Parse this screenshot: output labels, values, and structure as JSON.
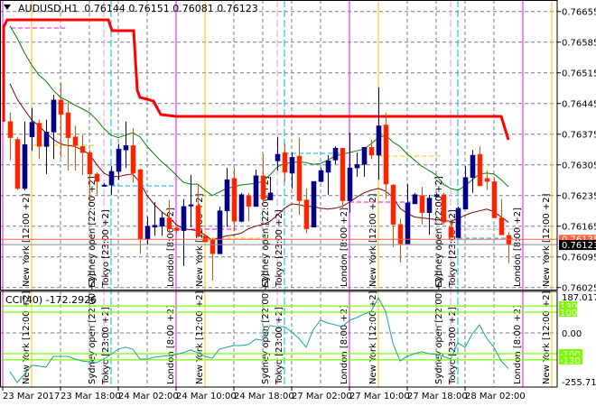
{
  "header": {
    "symbol": "AUDUSD,H1",
    "ohlc": "0.76144 0.76151 0.76081 0.76123",
    "menu_icon": "triangle-down-icon"
  },
  "cci": {
    "title": "CCI(40) -172.2926",
    "scale_max_label": "187.0175",
    "scale_zero_label": "0.00",
    "scale_min_label": "-255.7108",
    "levels": [
      130,
      100,
      -100,
      -130
    ],
    "level_labels": [
      "130",
      "100",
      "-100",
      "-130"
    ],
    "values": [
      -187,
      -239,
      -200,
      -156,
      -160,
      -165,
      -113,
      -113,
      -113,
      -126,
      -135,
      -139,
      -143,
      -126,
      -104,
      -78,
      -69,
      -78,
      -126,
      -126,
      -117,
      -113,
      -109,
      -104,
      -95,
      -82,
      -95,
      -113,
      -122,
      -78,
      -69,
      -61,
      -61,
      -56,
      -30,
      -35,
      35,
      30,
      30,
      4,
      -26,
      -69,
      17,
      61,
      48,
      39,
      30,
      61,
      74,
      91,
      104,
      169,
      104,
      -48,
      -135,
      -113,
      -100,
      -91,
      -100,
      -104,
      -113,
      -126,
      -48,
      -69,
      -4,
      39,
      -26,
      -69,
      -135,
      -172
    ]
  },
  "price_axis": {
    "labels": [
      "0.76655",
      "0.76585",
      "0.76515",
      "0.76445",
      "0.76375",
      "0.76305",
      "0.76235",
      "0.76165",
      "0.76095",
      "0.76025"
    ],
    "ask_label": "0.76135",
    "bid_label": "0.76123"
  },
  "time_axis": {
    "labels": [
      "23 Mar 2017",
      "23 Mar 18:00",
      "24 Mar 02:00",
      "24 Mar 10:00",
      "24 Mar 18:00",
      "27 Mar 02:00",
      "27 Mar 10:00",
      "27 Mar 18:00",
      "28 Mar 02:00"
    ]
  },
  "sessions": [
    {
      "label": "New York  [12:00 +2]",
      "color": "#FFC000"
    },
    {
      "label": "Sydney open  [22:00 +2]",
      "color": "#D8A0D8"
    },
    {
      "label": "Tokyo  [23:00 +2]",
      "color": "#00B0F0"
    },
    {
      "label": "London  [8:00 +2]",
      "color": "#FF00FF"
    }
  ],
  "colors": {
    "bull": "#000080",
    "bear": "#FF2000",
    "bear_wick": "#FF4500",
    "ma_fast": "#008000",
    "ma_slow": "#800000",
    "step_line": "#FF0000",
    "cci_line": "#20A0A0",
    "cci_level": "#7CFC00",
    "ask": "#FF6040",
    "bid": "#000000"
  },
  "candles": [
    [
      0.76404,
      0.76424,
      0.76316,
      0.76367
    ],
    [
      0.76363,
      0.76369,
      0.76247,
      0.76251
    ],
    [
      0.76251,
      0.76404,
      0.76247,
      0.76351
    ],
    [
      0.76369,
      0.76435,
      0.76337,
      0.76402
    ],
    [
      0.764,
      0.76408,
      0.76318,
      0.76347
    ],
    [
      0.76347,
      0.76408,
      0.76284,
      0.7638
    ],
    [
      0.7638,
      0.76465,
      0.76318,
      0.76453
    ],
    [
      0.76453,
      0.76492,
      0.76322,
      0.7642
    ],
    [
      0.76424,
      0.76449,
      0.76292,
      0.76367
    ],
    [
      0.76369,
      0.76394,
      0.76292,
      0.76349
    ],
    [
      0.76347,
      0.76373,
      0.76282,
      0.76333
    ],
    [
      0.76333,
      0.76339,
      0.7622,
      0.76284
    ],
    [
      0.76284,
      0.76288,
      0.76237,
      0.76267
    ],
    [
      0.76259,
      0.76263,
      0.76255,
      0.76259
    ],
    [
      0.76259,
      0.76302,
      0.76237,
      0.7629
    ],
    [
      0.7629,
      0.76353,
      0.76271,
      0.76341
    ],
    [
      0.76339,
      0.76404,
      0.76298,
      0.76349
    ],
    [
      0.76349,
      0.76388,
      0.76265,
      0.76286
    ],
    [
      0.76294,
      0.76296,
      0.76102,
      0.76135
    ],
    [
      0.76135,
      0.76186,
      0.76123,
      0.76165
    ],
    [
      0.76163,
      0.7622,
      0.76143,
      0.76167
    ],
    [
      0.76165,
      0.76196,
      0.76143,
      0.76184
    ],
    [
      0.76184,
      0.76225,
      0.76145,
      0.76159
    ],
    [
      0.76161,
      0.76165,
      0.76149,
      0.76155
    ],
    [
      0.76155,
      0.76227,
      0.76074,
      0.7621
    ],
    [
      0.76212,
      0.76282,
      0.76163,
      0.76214
    ],
    [
      0.76212,
      0.76261,
      0.76139,
      0.76143
    ],
    [
      0.76143,
      0.76145,
      0.76129,
      0.76129
    ],
    [
      0.76133,
      0.76139,
      0.76041,
      0.76102
    ],
    [
      0.76102,
      0.7621,
      0.76102,
      0.762
    ],
    [
      0.762,
      0.76298,
      0.76163,
      0.76271
    ],
    [
      0.76274,
      0.76298,
      0.76153,
      0.76176
    ],
    [
      0.76176,
      0.76241,
      0.76174,
      0.76237
    ],
    [
      0.76235,
      0.76241,
      0.76176,
      0.7621
    ],
    [
      0.7621,
      0.76294,
      0.7621,
      0.7628
    ],
    [
      0.7628,
      0.76329,
      0.76216,
      0.76227
    ],
    [
      0.76225,
      0.76278,
      0.76225,
      0.76241
    ],
    [
      0.76314,
      0.76369,
      0.76292,
      0.76329
    ],
    [
      0.76333,
      0.76353,
      0.76267,
      0.76288
    ],
    [
      0.76286,
      0.76333,
      0.76251,
      0.76322
    ],
    [
      0.76325,
      0.76367,
      0.7619,
      0.76223
    ],
    [
      0.76225,
      0.76251,
      0.76149,
      0.76159
    ],
    [
      0.76163,
      0.76267,
      0.76163,
      0.76267
    ],
    [
      0.76267,
      0.76298,
      0.76265,
      0.76292
    ],
    [
      0.76288,
      0.76327,
      0.76237,
      0.76314
    ],
    [
      0.76316,
      0.76347,
      0.76306,
      0.76343
    ],
    [
      0.76343,
      0.76343,
      0.76204,
      0.76223
    ],
    [
      0.76223,
      0.76378,
      0.76196,
      0.76298
    ],
    [
      0.76298,
      0.76333,
      0.76278,
      0.76306
    ],
    [
      0.76306,
      0.76345,
      0.76278,
      0.76345
    ],
    [
      0.76345,
      0.76363,
      0.76318,
      0.76327
    ],
    [
      0.76327,
      0.76482,
      0.76271,
      0.76394
    ],
    [
      0.76396,
      0.76424,
      0.76227,
      0.76261
    ],
    [
      0.76259,
      0.76261,
      0.76118,
      0.76169
    ],
    [
      0.76169,
      0.76182,
      0.76082,
      0.76125
    ],
    [
      0.76125,
      0.76261,
      0.76123,
      0.76218
    ],
    [
      0.76216,
      0.76241,
      0.76216,
      0.76237
    ],
    [
      0.76235,
      0.76255,
      0.76169,
      0.76196
    ],
    [
      0.76196,
      0.76237,
      0.76145,
      0.76229
    ],
    [
      0.76233,
      0.76241,
      0.76233,
      0.76237
    ],
    [
      0.76237,
      0.76241,
      0.76169,
      0.76174
    ],
    [
      0.76163,
      0.76176,
      0.76139,
      0.76139
    ],
    [
      0.76139,
      0.7621,
      0.76139,
      0.76206
    ],
    [
      0.76204,
      0.76302,
      0.76204,
      0.76276
    ],
    [
      0.76276,
      0.76339,
      0.76241,
      0.76327
    ],
    [
      0.76329,
      0.76347,
      0.76257,
      0.76257
    ],
    [
      0.76274,
      0.76292,
      0.76247,
      0.76267
    ],
    [
      0.76267,
      0.76274,
      0.76184,
      0.76184
    ],
    [
      0.76184,
      0.76227,
      0.76145,
      0.76145
    ],
    [
      0.76144,
      0.76151,
      0.76081,
      0.76123
    ]
  ],
  "ma_fast": [
    0.76622,
    0.76594,
    0.76561,
    0.76533,
    0.7651,
    0.76496,
    0.76475,
    0.76459,
    0.76451,
    0.76441,
    0.76433,
    0.76424,
    0.76408,
    0.76388,
    0.76373,
    0.76367,
    0.76373,
    0.76378,
    0.76369,
    0.76347,
    0.76329,
    0.76312,
    0.76298,
    0.76282,
    0.76265,
    0.76261,
    0.76261,
    0.76247,
    0.76235,
    0.76243,
    0.76251,
    0.76255,
    0.76259,
    0.76261,
    0.76263,
    0.76267,
    0.76282,
    0.763,
    0.76308,
    0.7631,
    0.76312,
    0.7631,
    0.76306,
    0.76308,
    0.76316,
    0.76325,
    0.76329,
    0.76333,
    0.76337,
    0.76341,
    0.76353,
    0.76367,
    0.76373,
    0.76357,
    0.76347,
    0.76329,
    0.76316,
    0.76302,
    0.76292,
    0.76282,
    0.76261,
    0.76251,
    0.76247,
    0.76257,
    0.76271,
    0.76284,
    0.76286,
    0.76284,
    0.76271,
    0.76255
  ],
  "ma_slow": [
    0.7649,
    0.76455,
    0.76431,
    0.76408,
    0.76394,
    0.76378,
    0.76363,
    0.76353,
    0.76349,
    0.76347,
    0.76339,
    0.76329,
    0.76306,
    0.76286,
    0.76278,
    0.76278,
    0.76282,
    0.76284,
    0.76265,
    0.76235,
    0.76214,
    0.76198,
    0.76186,
    0.76169,
    0.76159,
    0.76157,
    0.76155,
    0.76145,
    0.76133,
    0.76139,
    0.76143,
    0.76145,
    0.76149,
    0.76159,
    0.76165,
    0.76169,
    0.76176,
    0.7619,
    0.76206,
    0.76216,
    0.76214,
    0.7621,
    0.7621,
    0.76206,
    0.76204,
    0.76206,
    0.7621,
    0.7622,
    0.76231,
    0.76241,
    0.76247,
    0.76251,
    0.76245,
    0.76231,
    0.76206,
    0.76194,
    0.76186,
    0.76184,
    0.76182,
    0.7618,
    0.76178,
    0.76176,
    0.76182,
    0.7619,
    0.76196,
    0.762,
    0.76204,
    0.76198,
    0.76186,
    0.76174
  ]
}
